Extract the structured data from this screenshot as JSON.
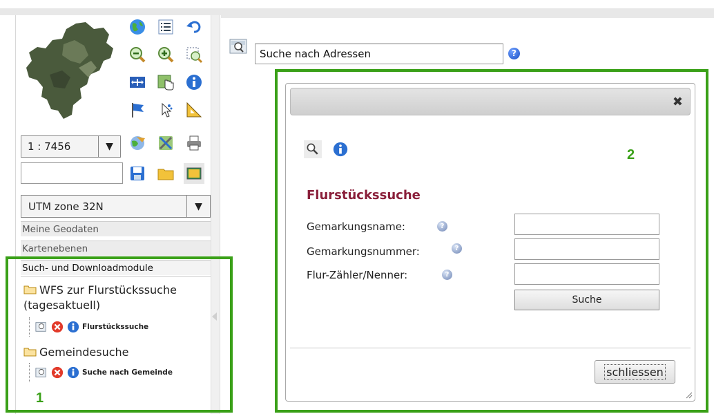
{
  "colors": {
    "marker_green": "#3aa018",
    "heading_red": "#8a1f3a",
    "help_blue": "#1a4fc4"
  },
  "toolbar": {
    "icons": [
      "globe-icon",
      "legend-list-icon",
      "undo-icon",
      "zoom-out-icon",
      "zoom-in-icon",
      "zoom-extent-icon",
      "pan-icon",
      "select-hand-icon",
      "info-icon",
      "flag-icon",
      "select-arrow-icon",
      "measure-icon",
      "globe-alt-icon",
      "tools-icon",
      "print-icon",
      "save-icon",
      "folder-icon",
      "image-icon"
    ],
    "scale_value": "1 : 7456",
    "scale_dropdown_glyph": "▼",
    "coordinate_value": "",
    "crs_value": "UTM zone 32N",
    "crs_dropdown_glyph": "▼"
  },
  "accordion": {
    "items": [
      "Meine Geodaten",
      "Kartenebenen",
      "Such- und Downloadmodule"
    ]
  },
  "tree": {
    "folder1": "WFS zur Flurstückssuche (tagesaktuell)",
    "leaf1": "Flurstückssuche",
    "folder2": "Gemeindesuche",
    "leaf2": "Suche nach Gemeinde"
  },
  "markers": {
    "left": "1",
    "right": "2"
  },
  "search": {
    "value": "Suche nach Adressen",
    "help_glyph": "?"
  },
  "dialog": {
    "close_glyph": "✖",
    "heading": "Flurstückssuche",
    "fields": [
      {
        "label": "Gemarkungsname:",
        "value": ""
      },
      {
        "label": "Gemarkungsnummer:",
        "value": ""
      },
      {
        "label": "Flur-Zähler/Nenner:",
        "value": ""
      }
    ],
    "help_glyph": "?",
    "submit_label": "Suche",
    "close_label": "schliessen"
  }
}
